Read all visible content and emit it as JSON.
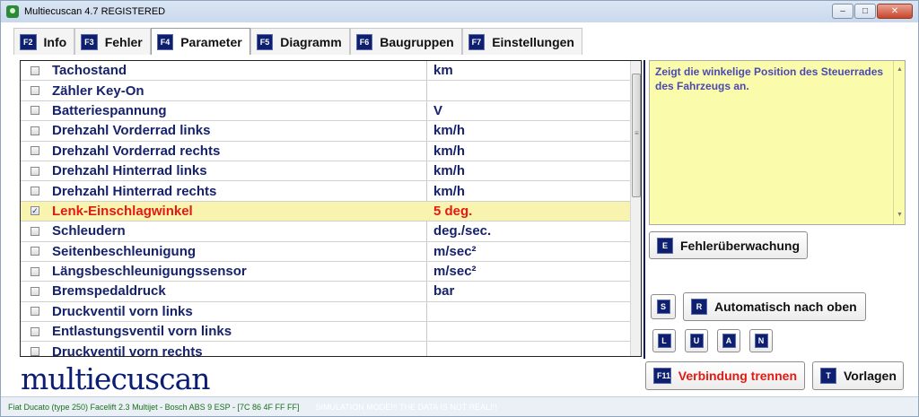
{
  "window": {
    "title": "Multiecuscan 4.7 REGISTERED",
    "controls": {
      "minimize": "–",
      "maximize": "□",
      "close": "✕"
    }
  },
  "tabs": [
    {
      "key": "F2",
      "label": "Info"
    },
    {
      "key": "F3",
      "label": "Fehler"
    },
    {
      "key": "F4",
      "label": "Parameter",
      "active": true
    },
    {
      "key": "F5",
      "label": "Diagramm"
    },
    {
      "key": "F6",
      "label": "Baugruppen"
    },
    {
      "key": "F7",
      "label": "Einstellungen"
    }
  ],
  "parameters": [
    {
      "name": "Tachostand",
      "unit": "km",
      "checked": false
    },
    {
      "name": "Zähler Key-On",
      "unit": "",
      "checked": false
    },
    {
      "name": "Batteriespannung",
      "unit": "V",
      "checked": false
    },
    {
      "name": "Drehzahl Vorderrad links",
      "unit": "km/h",
      "checked": false
    },
    {
      "name": "Drehzahl Vorderrad rechts",
      "unit": "km/h",
      "checked": false
    },
    {
      "name": "Drehzahl Hinterrad links",
      "unit": "km/h",
      "checked": false
    },
    {
      "name": "Drehzahl Hinterrad rechts",
      "unit": "km/h",
      "checked": false
    },
    {
      "name": "Lenk-Einschlagwinkel",
      "unit": "5 deg.",
      "checked": true,
      "selected": true
    },
    {
      "name": "Schleudern",
      "unit": "deg./sec.",
      "checked": false
    },
    {
      "name": "Seitenbeschleunigung",
      "unit": "m/sec²",
      "checked": false
    },
    {
      "name": "Längsbeschleunigungssensor",
      "unit": "m/sec²",
      "checked": false
    },
    {
      "name": "Bremspedaldruck",
      "unit": "bar",
      "checked": false
    },
    {
      "name": "Druckventil vorn links",
      "unit": "",
      "checked": false
    },
    {
      "name": "Entlastungsventil vorn links",
      "unit": "",
      "checked": false
    },
    {
      "name": "Druckventil vorn rechts",
      "unit": "",
      "checked": false
    }
  ],
  "description": "Zeigt die winkelige Position des Steuerrades des Fahrzeugs an.",
  "buttons": {
    "fehlerueberwachung": {
      "key": "E",
      "label": "Fehlerüberwachung"
    },
    "s": {
      "key": "S"
    },
    "automatisch": {
      "key": "R",
      "label": "Automatisch nach oben"
    },
    "l": {
      "key": "L"
    },
    "u": {
      "key": "U"
    },
    "a": {
      "key": "A"
    },
    "n": {
      "key": "N"
    },
    "verbindung": {
      "key": "F11",
      "label": "Verbindung trennen"
    },
    "vorlagen": {
      "key": "T",
      "label": "Vorlagen"
    }
  },
  "logo": "multiecuscan",
  "status": {
    "vehicle": "Fiat Ducato (type 250) Facelift 2.3 Multijet - Bosch ABS 9 ESP - [7C 86 4F FF FF]",
    "simulation": "SIMULATION MODE!!! THE DATA IS NOT REAL!!!"
  },
  "colors": {
    "navy": "#16226a",
    "selected_row": "#f8f4b0",
    "selected_text": "#e21a12",
    "description_bg": "#fbfbac",
    "key_badge": "#0d1f6e"
  }
}
